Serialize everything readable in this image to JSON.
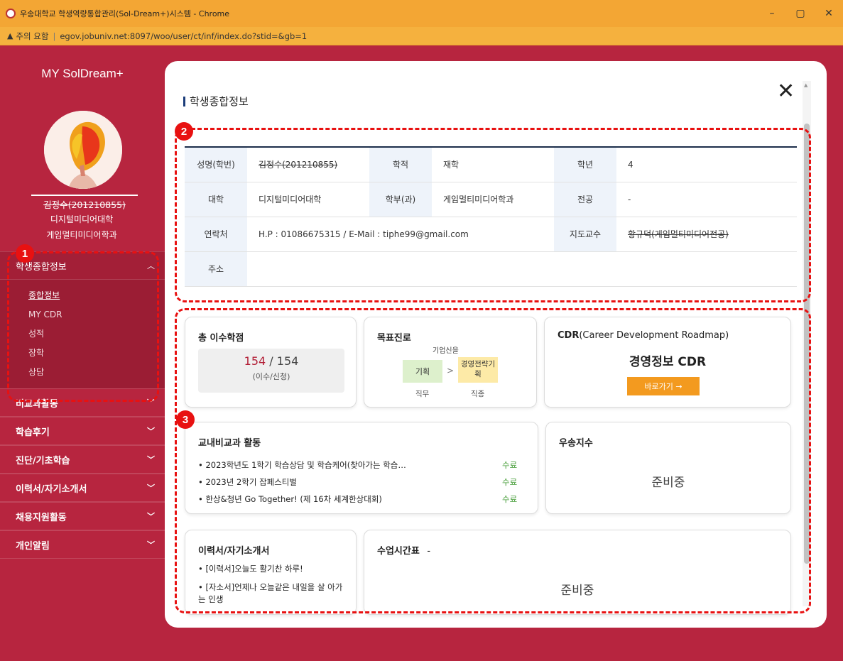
{
  "window": {
    "title": "우송대학교 학생역량통합관리(Sol-Dream+)시스템 - Chrome",
    "warning": "주의 요함",
    "url": "egov.jobuniv.net:8097/woo/user/ct/inf/index.do?stid=&gb=1",
    "controls": {
      "minimize": "–",
      "maximize": "▢",
      "close": "✕"
    }
  },
  "sidebar": {
    "app_title": "MY SolDream+",
    "user_name": "김정수(201210855)",
    "user_college": "디지털미디어대학",
    "user_dept": "게임멀티미디어학과",
    "menu_open": {
      "label": "학생종합정보",
      "items": [
        "종합정보",
        "MY CDR",
        "성적",
        "장학",
        "상담"
      ]
    },
    "menu": [
      "비교과활동",
      "학습후기",
      "진단/기초학습",
      "이력서/자기소개서",
      "채용지원활동",
      "개인알림"
    ]
  },
  "annotations": {
    "one": "1",
    "two": "2",
    "three": "3"
  },
  "modal": {
    "title": "학생종합정보",
    "close": "✕",
    "info": {
      "name_label": "성명(학번)",
      "name_value": "김정수(201210855)",
      "status_label": "학적",
      "status_value": "재학",
      "grade_label": "학년",
      "grade_value": "4",
      "college_label": "대학",
      "college_value": "디지털미디어대학",
      "dept_label": "학부(과)",
      "dept_value": "게임멀티미디어학과",
      "major_label": "전공",
      "major_value": "-",
      "contact_label": "연락처",
      "contact_value": "H.P : 01086675315 / E-Mail : tiphe99@gmail.com",
      "advisor_label": "지도교수",
      "advisor_value": "황규덕(게임멀티미디어전공)",
      "address_label": "주소",
      "address_value": ""
    },
    "credits": {
      "title": "총 이수학점",
      "completed": "154",
      "separator": " / ",
      "applied": "154",
      "label": "(이수/신청)"
    },
    "goal": {
      "title": "목표진로",
      "top": "기업신을",
      "job": "기획",
      "arrow": ">",
      "type": "경영전략기획",
      "job_label": "직무",
      "type_label": "직종"
    },
    "cdr": {
      "title": "CDR",
      "title_sub": "(Career Development Roadmap)",
      "name": "경영정보 CDR",
      "button": "바로가기 →"
    },
    "activities": {
      "title": "교내비교과 활동",
      "rows": [
        {
          "text": "• 2023학년도 1학기 학습상담 및 학습케어(찾아가는 학습…",
          "status": "수료"
        },
        {
          "text": "• 2023년 2학기 잡페스티벌",
          "status": "수료"
        },
        {
          "text": "• 한상&청년 Go Together! (제 16차 세계한상대회)",
          "status": "수료"
        }
      ]
    },
    "index": {
      "title": "우송지수",
      "status": "준비중"
    },
    "resume": {
      "title": "이력서/자기소개서",
      "rows": [
        "• [이력서]오늘도 활기찬 하루!",
        "• [자소서]언제나 오늘같은 내일을 살 아가는 인생"
      ]
    },
    "timetable": {
      "title": "수업시간표",
      "dash": "-",
      "status": "준비중"
    }
  }
}
